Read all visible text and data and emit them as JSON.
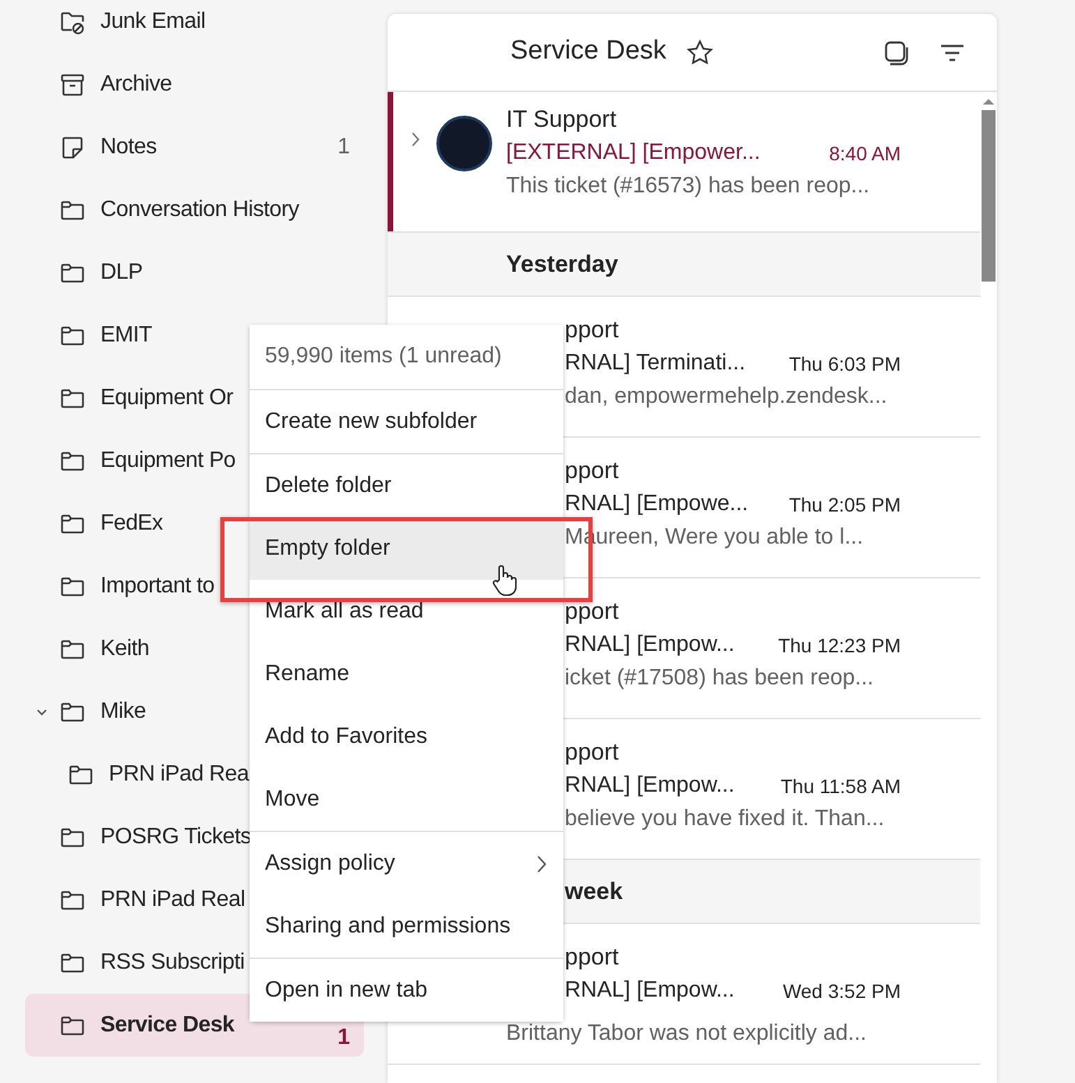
{
  "sidebar": {
    "items": [
      {
        "label": "Junk Email",
        "kind": "junk",
        "selected": false
      },
      {
        "label": "Archive",
        "kind": "archive",
        "selected": false
      },
      {
        "label": "Notes",
        "kind": "note",
        "count": "1",
        "selected": false
      },
      {
        "label": "Conversation History",
        "kind": "folder",
        "selected": false
      },
      {
        "label": "DLP",
        "kind": "folder",
        "selected": false
      },
      {
        "label": "EMIT",
        "kind": "folder",
        "selected": false
      },
      {
        "label": "Equipment Or",
        "kind": "folder",
        "selected": false
      },
      {
        "label": "Equipment Po",
        "kind": "folder",
        "selected": false
      },
      {
        "label": "FedEx",
        "kind": "folder",
        "selected": false
      },
      {
        "label": "Important to",
        "kind": "folder",
        "selected": false
      },
      {
        "label": "Keith",
        "kind": "folder",
        "selected": false
      },
      {
        "label": "Mike",
        "kind": "folder",
        "selected": false,
        "expanded": true,
        "children": [
          {
            "label": "PRN iPad Rea",
            "kind": "folder",
            "selected": false
          }
        ]
      },
      {
        "label": "POSRG Tickets",
        "kind": "folder",
        "selected": false
      },
      {
        "label": "PRN iPad Real",
        "kind": "folder",
        "selected": false
      },
      {
        "label": "RSS Subscripti",
        "kind": "folder",
        "selected": false
      },
      {
        "label": "Service Desk",
        "kind": "folder",
        "count": "1",
        "selected": true
      }
    ]
  },
  "message_list": {
    "title": "Service Desk",
    "groups": [
      {
        "kind": "none",
        "messages": [
          {
            "kind": "full",
            "sender": "IT Support",
            "subject": "[EXTERNAL] [Empower...",
            "time": "8:40 AM",
            "preview": "This ticket (#16573) has been reop...",
            "unread": true
          }
        ]
      },
      {
        "kind": "full",
        "label": "Yesterday",
        "messages": [
          {
            "kind": "covered",
            "sender": "pport",
            "subject": "RNAL] Terminati...",
            "time": "Thu 6:03 PM",
            "preview": "dan, empowermehelp.zendesk...",
            "unread": false
          },
          {
            "kind": "covered",
            "sender": "pport",
            "subject": "RNAL] [Empowe...",
            "time": "Thu 2:05 PM",
            "preview": "Maureen, Were you able to l...",
            "unread": false
          },
          {
            "kind": "covered",
            "sender": "pport",
            "subject": "RNAL] [Empow...",
            "time": "Thu 12:23 PM",
            "preview": "icket (#17508) has been reop...",
            "unread": false
          },
          {
            "kind": "covered",
            "sender": "pport",
            "subject": "RNAL] [Empow...",
            "time": "Thu 11:58 AM",
            "preview": "believe you have fixed it. Than...",
            "unread": false
          }
        ]
      },
      {
        "kind": "covered",
        "label": "week",
        "messages": [
          {
            "kind": "partial",
            "sender": "pport",
            "subject": "RNAL] [Empow...",
            "time": "Wed 3:52 PM",
            "preview": "Brittany Tabor was not explicitly ad...",
            "unread": false
          }
        ]
      }
    ]
  },
  "context_menu": {
    "items": [
      {
        "kind": "info",
        "label": "59,990 items (1 unread)"
      },
      {
        "kind": "divider"
      },
      {
        "kind": "action",
        "label": "Create new subfolder",
        "highlighted": false
      },
      {
        "kind": "divider"
      },
      {
        "kind": "action",
        "label": "Delete folder",
        "highlighted": false
      },
      {
        "kind": "action",
        "label": "Empty folder",
        "highlighted": true
      },
      {
        "kind": "action",
        "label": "Mark all as read",
        "highlighted": false
      },
      {
        "kind": "action",
        "label": "Rename",
        "highlighted": false
      },
      {
        "kind": "action",
        "label": "Add to Favorites",
        "highlighted": false
      },
      {
        "kind": "action",
        "label": "Move",
        "highlighted": false
      },
      {
        "kind": "divider"
      },
      {
        "kind": "submenu",
        "label": "Assign policy",
        "highlighted": false
      },
      {
        "kind": "action",
        "label": "Sharing and permissions",
        "highlighted": false
      },
      {
        "kind": "divider"
      },
      {
        "kind": "action",
        "label": "Open in new tab",
        "highlighted": false
      }
    ]
  }
}
